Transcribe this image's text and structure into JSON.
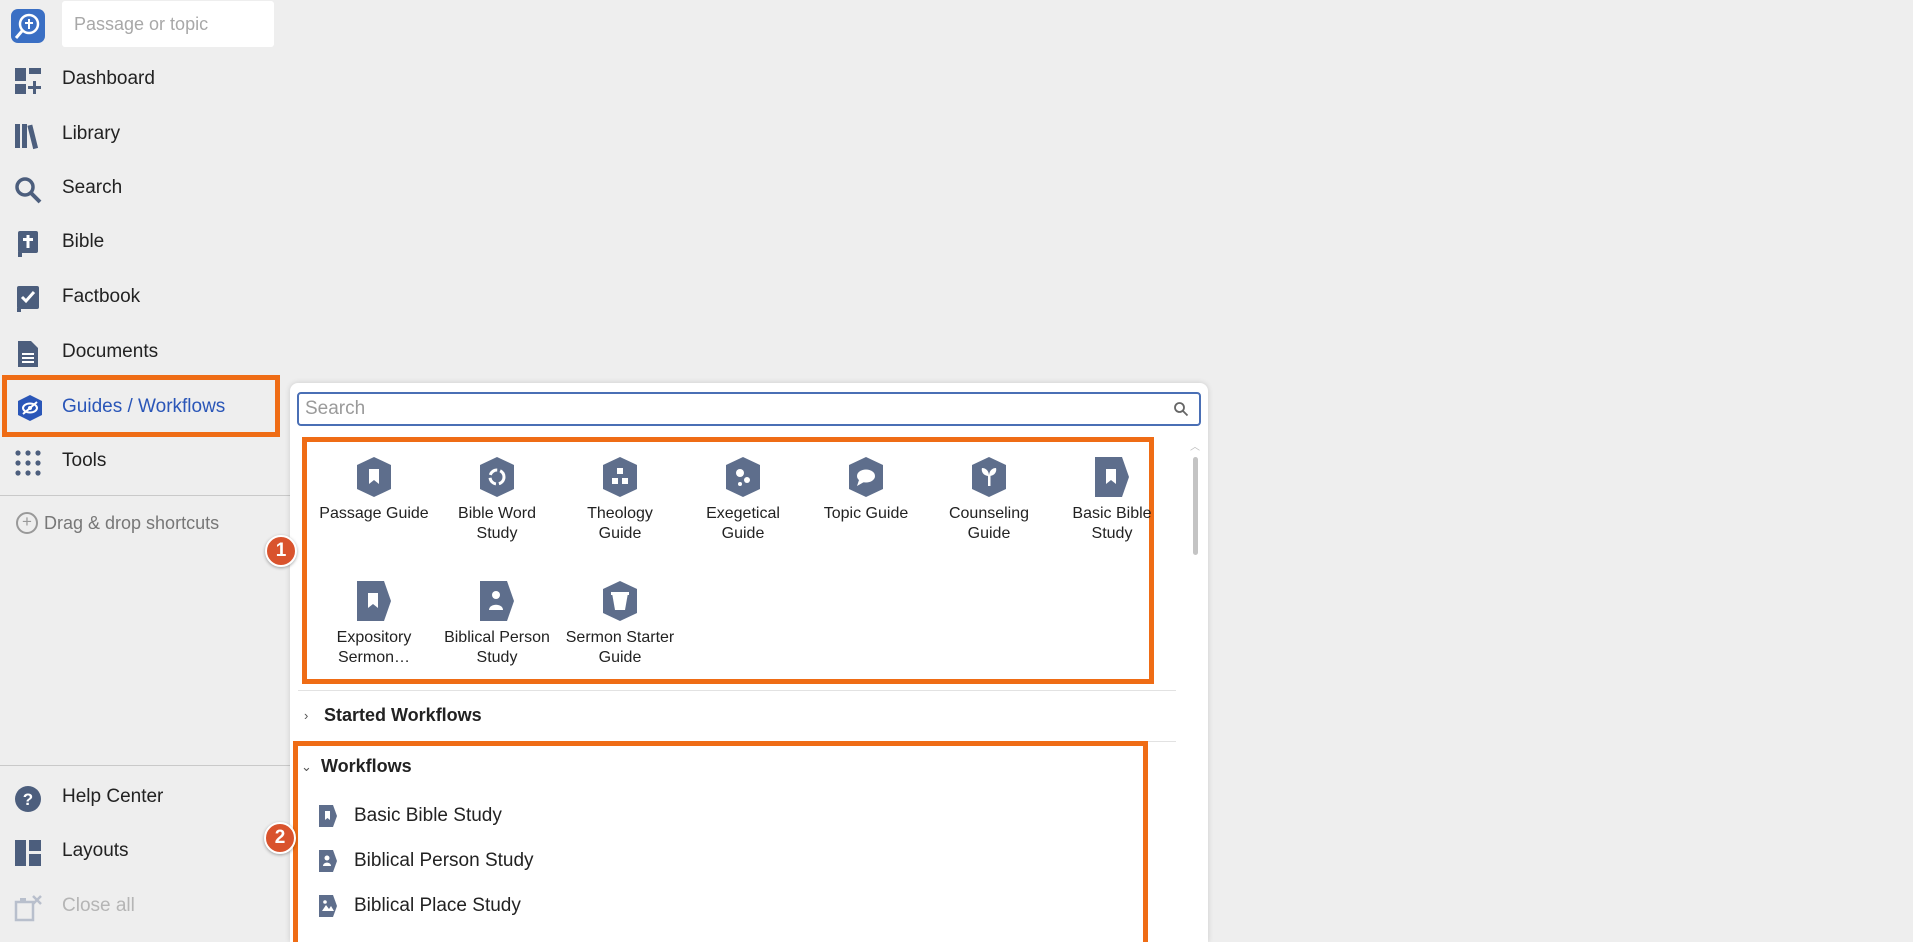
{
  "sidebar": {
    "passage_placeholder": "Passage or topic",
    "items": [
      {
        "label": "Dashboard",
        "icon": "dashboard-icon"
      },
      {
        "label": "Library",
        "icon": "library-icon"
      },
      {
        "label": "Search",
        "icon": "search-icon"
      },
      {
        "label": "Bible",
        "icon": "bible-icon"
      },
      {
        "label": "Factbook",
        "icon": "factbook-icon"
      },
      {
        "label": "Documents",
        "icon": "documents-icon"
      },
      {
        "label": "Guides / Workflows",
        "icon": "guides-icon",
        "active": true
      },
      {
        "label": "Tools",
        "icon": "tools-grid-icon"
      }
    ],
    "drag_drop": "Drag & drop shortcuts",
    "bottom_items": [
      {
        "label": "Help Center",
        "icon": "help-icon"
      },
      {
        "label": "Layouts",
        "icon": "layouts-icon"
      },
      {
        "label": "Close all",
        "icon": "close-all-icon",
        "disabled": true
      }
    ],
    "accent_color": "#2a56b8",
    "highlight_color": "#ef6c15"
  },
  "panel": {
    "search_placeholder": "Search",
    "guides": [
      {
        "label": "Passage Guide",
        "icon": "bookmark-icon"
      },
      {
        "label": "Bible Word Study",
        "icon": "word-study-icon"
      },
      {
        "label": "Theology Guide",
        "icon": "theology-icon"
      },
      {
        "label": "Exegetical Guide",
        "icon": "exegetical-icon"
      },
      {
        "label": "Topic Guide",
        "icon": "speech-bubble-icon"
      },
      {
        "label": "Counseling Guide",
        "icon": "sprout-icon"
      },
      {
        "label": "Basic Bible Study",
        "icon": "bookmark-icon"
      },
      {
        "label": "Expository Sermon…",
        "icon": "bookmark-icon"
      },
      {
        "label": "Biblical Person Study",
        "icon": "person-icon"
      },
      {
        "label": "Sermon Starter Guide",
        "icon": "pulpit-icon"
      }
    ],
    "started_workflows_label": "Started Workflows",
    "workflows_label": "Workflows",
    "workflows": [
      {
        "label": "Basic Bible Study",
        "icon": "bookmark-icon"
      },
      {
        "label": "Biblical Person Study",
        "icon": "person-icon"
      },
      {
        "label": "Biblical Place Study",
        "icon": "image-icon"
      }
    ]
  },
  "callouts": [
    "1",
    "2"
  ]
}
